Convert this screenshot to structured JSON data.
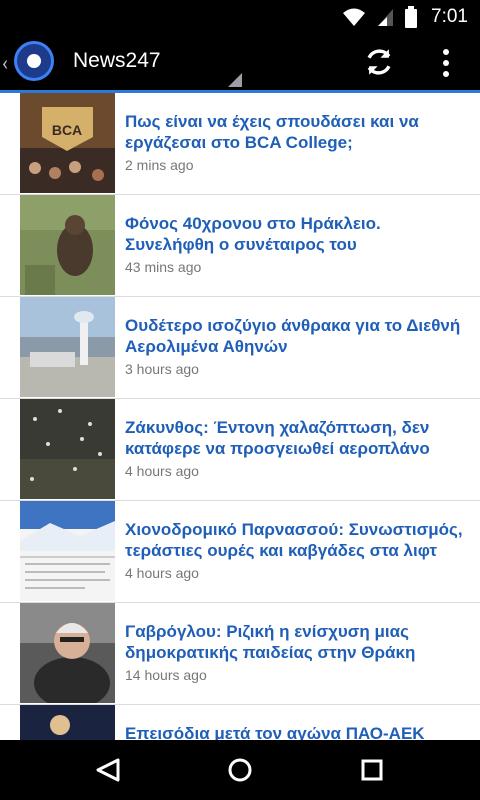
{
  "status": {
    "time": "7:01"
  },
  "app": {
    "title": "News247"
  },
  "news": [
    {
      "headline": "Πως είναι να έχεις σπουδάσει και να εργάζεσαι στο BCA College;",
      "time": "2 mins ago"
    },
    {
      "headline": "Φόνος 40χρονου στο Ηράκλειο. Συνελήφθη ο συνέταιρος του",
      "time": "43 mins ago"
    },
    {
      "headline": "Ουδέτερο ισοζύγιο άνθρακα για το Διεθνή Αερολιμένα Αθηνών",
      "time": "3 hours ago"
    },
    {
      "headline": "Ζάκυνθος: Έντονη χαλαζόπτωση, δεν κατάφερε να προσγειωθεί αεροπλάνο",
      "time": "4 hours ago"
    },
    {
      "headline": "Χιονοδρομικό Παρνασσού: Συνωστισμός, τεράστιες ουρές και καβγάδες στα λιφτ",
      "time": "4 hours ago"
    },
    {
      "headline": "Γαβρόγλου: Ριζική η ενίσχυση μιας δημοκρατικής παιδείας στην Θράκη",
      "time": "14 hours ago"
    },
    {
      "headline": "Επεισόδια μετά τον αγώνα ΠΑΟ-ΑΕΚ",
      "time": ""
    }
  ]
}
